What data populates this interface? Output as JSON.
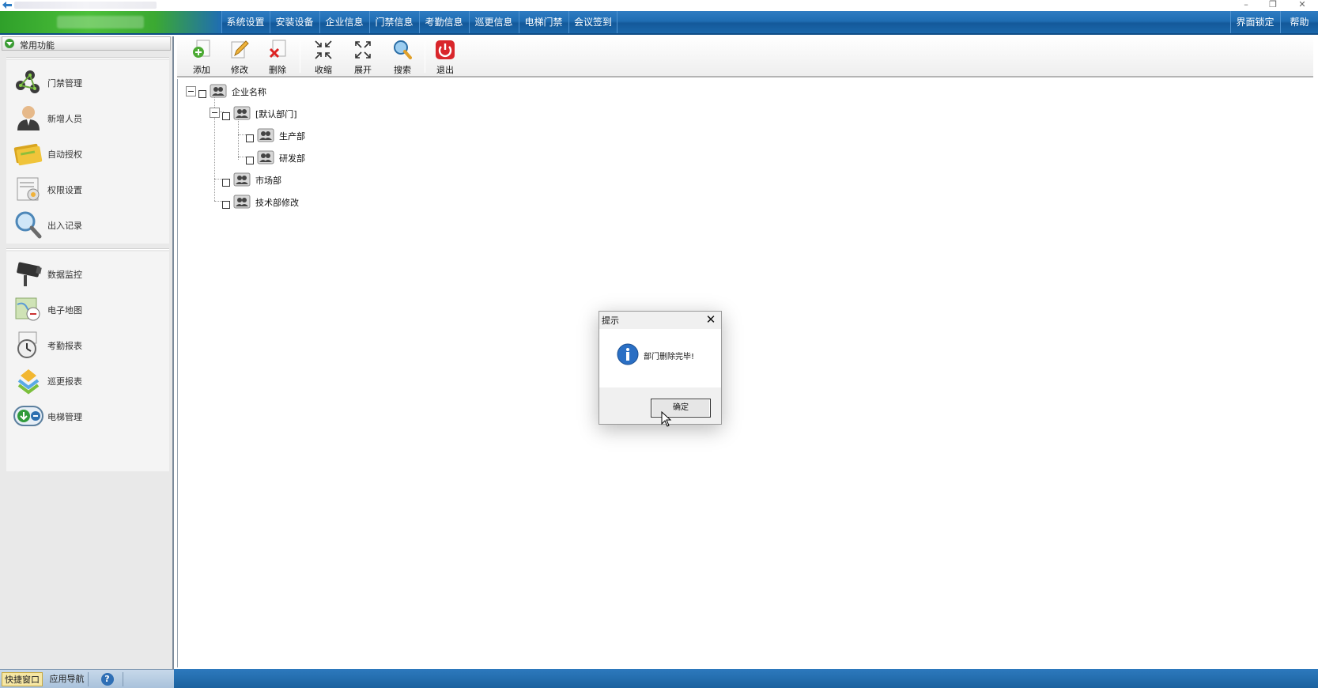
{
  "window": {
    "controls": [
      "–",
      "❐",
      "✕"
    ]
  },
  "menu": {
    "items": [
      "系统设置",
      "安装设备",
      "企业信息",
      "门禁信息",
      "考勤信息",
      "巡更信息",
      "电梯门禁",
      "会议签到"
    ],
    "right_items": [
      "界面锁定",
      "帮助"
    ]
  },
  "left_panel": {
    "title": "常用功能",
    "group1": [
      "门禁管理",
      "新增人员",
      "自动授权",
      "权限设置",
      "出入记录"
    ],
    "group2": [
      "数据监控",
      "电子地图",
      "考勤报表",
      "巡更报表",
      "电梯管理"
    ],
    "footer_tabs": [
      "快捷窗口",
      "应用导航",
      "?"
    ]
  },
  "toolbar": {
    "add": "添加",
    "edit": "修改",
    "delete": "删除",
    "collapse": "收缩",
    "expand": "展开",
    "search": "搜索",
    "exit": "退出"
  },
  "tree": {
    "root": "企业名称",
    "default_dept": "[默认部门]",
    "production": "生产部",
    "rnd": "研发部",
    "market": "市场部",
    "tech": "技术部修改"
  },
  "dialog": {
    "title": "提示",
    "close": "✕",
    "message": "部门删除完毕!",
    "ok": "确定"
  },
  "colors": {
    "menu_blue": "#1f6db3",
    "brand_green": "#3ba932",
    "panel_gray": "#e9e9e9",
    "exit_red": "#d9262b"
  }
}
